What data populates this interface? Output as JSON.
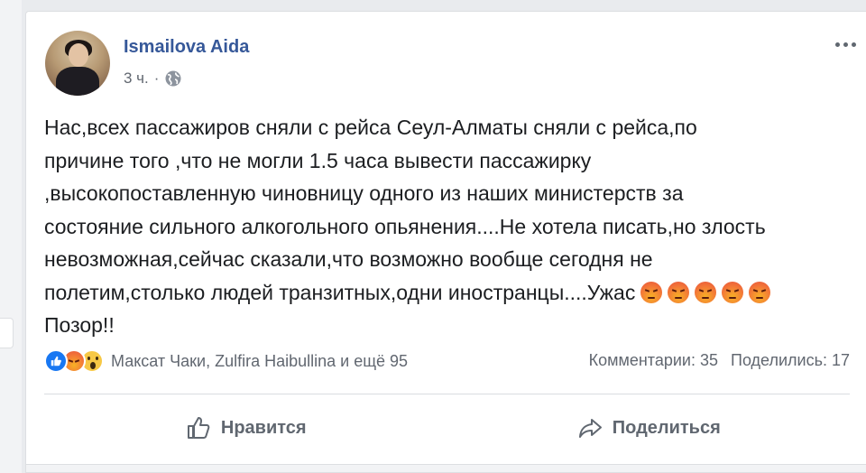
{
  "post": {
    "author": "Ismailova Aida",
    "time": "3 ч.",
    "separator": "·",
    "privacy_icon": "globe-icon",
    "body_lines": [
      "Нас,всех пассажиров сняли с рейса Сеул-Алматы сняли с рейса,по",
      "причине того ,что не могли 1.5 часа вывести пассажирку",
      ",высокопоставленную чиновницу одного из наших министерств за",
      "состояние сильного алкогольного опьянения....Не хотела писать,но злость",
      "невозможная,сейчас сказали,что возможно вообще сегодня не",
      "полетим,столько людей транзитных,одни иностранцы....Ужас"
    ],
    "body_last_line": "Позор!!",
    "trailing_emoji": [
      "angry-icon",
      "angry-icon",
      "angry-icon",
      "angry-icon",
      "angry-icon"
    ]
  },
  "reactions": {
    "icons": [
      "like-icon",
      "angry-icon",
      "wow-icon"
    ],
    "reactors_text": "Максат Чаки, Zulfira Haibullina и ещё 95",
    "comments": "Комментарии: 35",
    "shares": "Поделились: 17"
  },
  "actions": {
    "like_label": "Нравится",
    "share_label": "Поделиться"
  },
  "colors": {
    "author_link": "#365899",
    "secondary_text": "#616770",
    "like_blue": "#1877f2"
  }
}
